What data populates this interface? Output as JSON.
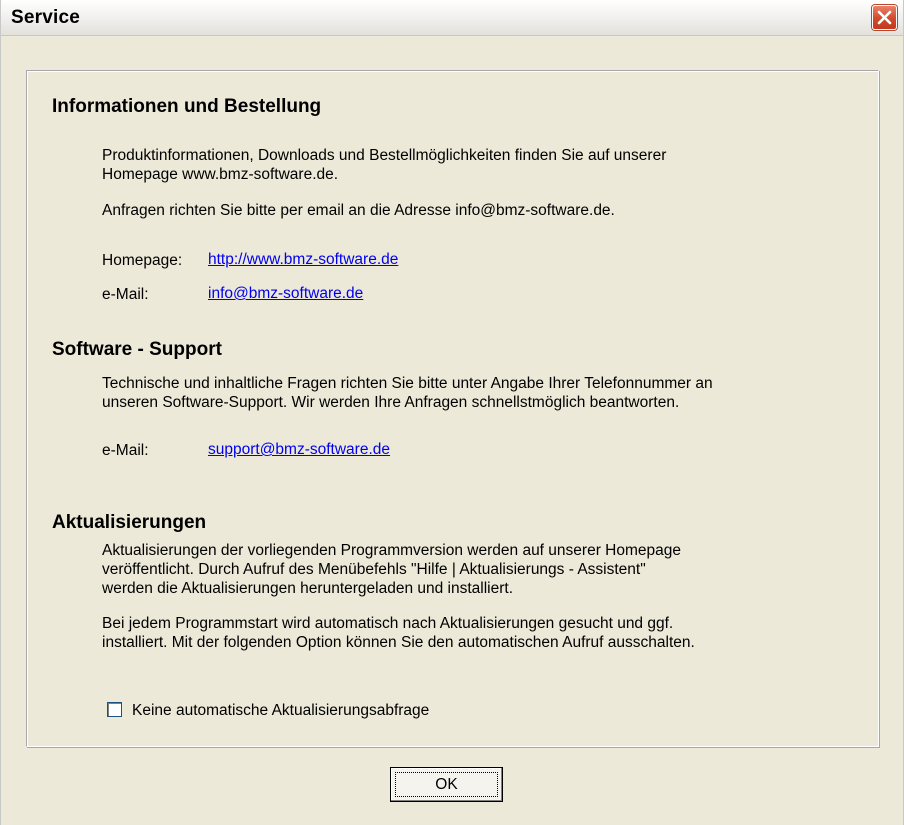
{
  "window": {
    "title": "Service"
  },
  "info": {
    "heading": "Informationen und Bestellung",
    "line1": "Produktinformationen, Downloads und Bestellmöglichkeiten finden Sie auf unserer",
    "line2": "Homepage www.bmz-software.de.",
    "line3": "Anfragen richten Sie bitte per email an die Adresse info@bmz-software.de.",
    "homepage_label": "Homepage:",
    "homepage_link": "http://www.bmz-software.de",
    "email_label": "e-Mail:",
    "email_link": "info@bmz-software.de"
  },
  "support": {
    "heading": "Software - Support",
    "line1": "Technische und inhaltliche Fragen richten Sie bitte unter Angabe Ihrer Telefonnummer an",
    "line2": "unseren Software-Support. Wir werden Ihre Anfragen schnellstmöglich beantworten.",
    "email_label": "e-Mail:",
    "email_link": "support@bmz-software.de"
  },
  "updates": {
    "heading": "Aktualisierungen",
    "line1": "Aktualisierungen der vorliegenden Programmversion werden auf unserer Homepage",
    "line2": "veröffentlicht. Durch Aufruf des Menübefehls \"Hilfe | Aktualisierungs - Assistent\"",
    "line3": "werden die Aktualisierungen heruntergeladen und installiert.",
    "line4": "Bei jedem Programmstart wird automatisch nach Aktualisierungen gesucht und ggf.",
    "line5": "installiert. Mit der folgenden Option können Sie den automatischen Aufruf ausschalten.",
    "checkbox_label": "Keine automatische Aktualisierungsabfrage",
    "checkbox_checked": false
  },
  "buttons": {
    "ok": "OK"
  },
  "icons": {
    "close": "close-icon"
  },
  "colors": {
    "link": "#0000ee",
    "dialog_bg": "#ece9d8",
    "close_red": "#d2482a"
  }
}
